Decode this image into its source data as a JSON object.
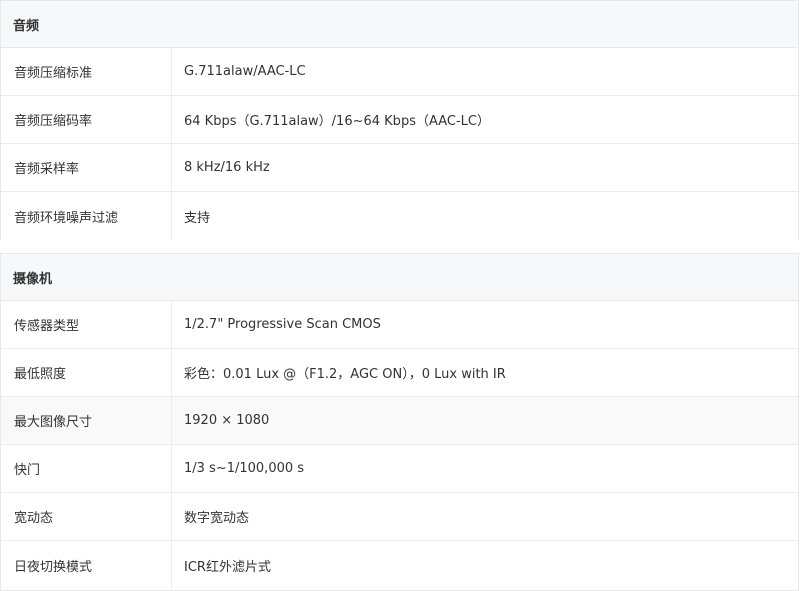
{
  "audio": {
    "title": "音频",
    "rows": [
      {
        "label": "音频压缩标准",
        "value": "G.711alaw/AAC-LC"
      },
      {
        "label": "音频压缩码率",
        "value": "64 Kbps（G.711alaw）/16~64 Kbps（AAC-LC）"
      },
      {
        "label": "音频采样率",
        "value": "8 kHz/16 kHz"
      },
      {
        "label": "音频环境噪声过滤",
        "value": "支持"
      }
    ]
  },
  "camera": {
    "title": "摄像机",
    "rows": [
      {
        "label": "传感器类型",
        "value": "1/2.7\" Progressive Scan CMOS"
      },
      {
        "label": "最低照度",
        "value": "彩色：0.01 Lux @（F1.2，AGC ON），0 Lux with IR"
      },
      {
        "label": "最大图像尺寸",
        "value": "1920 × 1080"
      },
      {
        "label": "快门",
        "value": "1/3 s~1/100,000 s"
      },
      {
        "label": "宽动态",
        "value": "数字宽动态"
      },
      {
        "label": "日夜切换模式",
        "value": "ICR红外滤片式"
      }
    ]
  }
}
